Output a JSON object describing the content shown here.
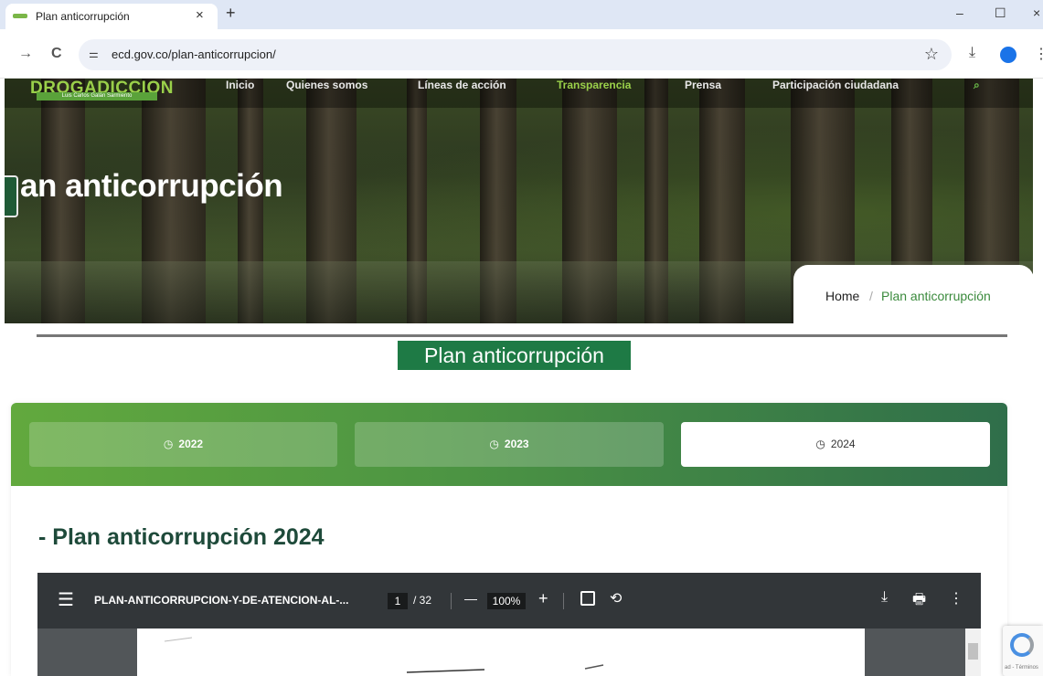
{
  "browser": {
    "tab_title": "Plan anticorrupción",
    "tab_close": "×",
    "new_tab": "+",
    "minimize": "–",
    "maximize": "☐",
    "close": "×",
    "back": "→",
    "reload": "C",
    "site_settings_icon": "tune-icon",
    "url": "ecd.gov.co/plan-anticorrupcion/",
    "star": "☆",
    "download": "⤓",
    "menu": "⋮"
  },
  "site": {
    "logo_text": "DROGADICCION",
    "logo_sub": "Luis Carlos Galán Sarmiento",
    "nav": [
      "Inicio",
      "Quienes somos",
      "Líneas de acción",
      "Transparencia",
      "Prensa",
      "Participación ciudadana"
    ],
    "hero_title": "an anticorrupción",
    "breadcrumb": {
      "home": "Home",
      "sep": "/",
      "current": "Plan anticorrupción"
    }
  },
  "main": {
    "section_title": "Plan anticorrupción",
    "year_tabs": [
      {
        "icon": "clock-icon",
        "label": "2022"
      },
      {
        "icon": "clock-icon",
        "label": "2023"
      },
      {
        "icon": "clock-icon",
        "label": "2024"
      }
    ],
    "active_year": "2024",
    "content_title": "- Plan anticorrupción 2024"
  },
  "pdf": {
    "menu_icon": "☰",
    "filename": "PLAN-ANTICORRUPCION-Y-DE-ATENCION-AL-...",
    "page_current": "1",
    "page_total": "/ 32",
    "zoom_out": "—",
    "zoom": "100%",
    "zoom_in": "+",
    "download_icon": "⤓",
    "print_icon": "🖶",
    "more_icon": "⋮"
  },
  "recaptcha": {
    "text": "ad - Términos"
  },
  "colors": {
    "brand_green": "#1e7a45",
    "accent_green": "#62a93e",
    "dark_green": "#2f6e4a"
  }
}
